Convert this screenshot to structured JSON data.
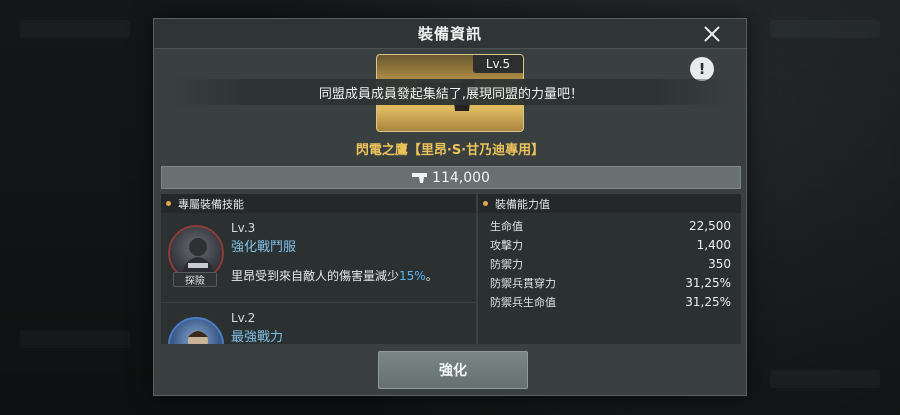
{
  "dialog": {
    "title": "裝備資訊",
    "notice": "同盟成員成員發起集結了,展現同盟的力量吧！"
  },
  "equipment": {
    "level": "Lv.5",
    "name": "閃電之鷹【里昂·S·甘乃迪專用】",
    "price": "114,000",
    "card_color": "#d4ad58"
  },
  "skills_panel": {
    "title": "專屬裝備技能",
    "skills": [
      {
        "level": "Lv.3",
        "name": "強化戰鬥服",
        "tag": "探險",
        "desc_prefix": "里昂受到來自敵人的傷害量減少",
        "desc_highlight": "15%",
        "desc_suffix": "。",
        "icon": "rpd-soldier-icon"
      },
      {
        "level": "Lv.2",
        "name": "最強戰力",
        "icon": "operator-icon"
      }
    ]
  },
  "stats_panel": {
    "title": "裝備能力值",
    "rows": [
      {
        "label": "生命值",
        "value": "22,500"
      },
      {
        "label": "攻擊力",
        "value": "1,400"
      },
      {
        "label": "防禦力",
        "value": "350"
      },
      {
        "label": "防禦兵貫穿力",
        "value": "31,25%"
      },
      {
        "label": "防禦兵生命值",
        "value": "31,25%"
      }
    ]
  },
  "actions": {
    "enhance_label": "強化"
  },
  "colors": {
    "accent_gold": "#ecc25a",
    "skill_name_blue": "#7fc0e8",
    "highlight_blue": "#5ab4ea"
  }
}
